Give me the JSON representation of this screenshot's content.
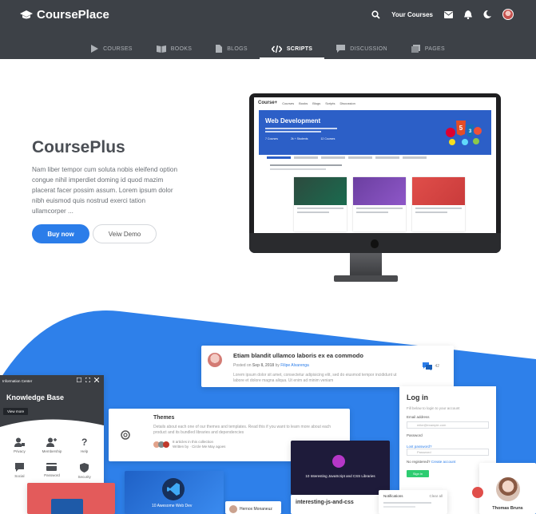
{
  "header": {
    "brand": "CoursePlace",
    "your_courses": "Your Courses",
    "icons": [
      "search-icon",
      "mail-icon",
      "bell-icon",
      "moon-icon",
      "avatar"
    ]
  },
  "tabs": [
    {
      "label": "COURSES",
      "icon": "play-icon",
      "active": false
    },
    {
      "label": "BOOKS",
      "icon": "book-icon",
      "active": false
    },
    {
      "label": "BLOGS",
      "icon": "document-icon",
      "active": false
    },
    {
      "label": "SCRIPTS",
      "icon": "code-icon",
      "active": true
    },
    {
      "label": "DISCUSSION",
      "icon": "chat-icon",
      "active": false
    },
    {
      "label": "PAGES",
      "icon": "pages-icon",
      "active": false
    }
  ],
  "hero": {
    "title": "CoursePlus",
    "text": "Nam liber tempor cum soluta nobis eleifend option congue nihil imperdiet doming id quod mazim placerat facer possim assum. Lorem ipsum dolor nibh euismod quis nostrud exerci tation ullamcorper ...",
    "buy_label": "Buy now",
    "demo_label": "Veiw Demo"
  },
  "screen": {
    "logo": "Course+",
    "hero_title": "Web Development",
    "nav": [
      "Courses",
      "Books",
      "Blogs",
      "Scripts",
      "Discussion"
    ],
    "stats": [
      "7 Courses",
      "2k + Students",
      "12 Courses"
    ]
  },
  "post": {
    "title": "Etiam blandit ullamco laboris ex ea commodo",
    "meta_prefix": "Posted on",
    "date": "Sep 8, 2018",
    "by": "by",
    "author": "Filipe Alvarenga",
    "text": "Lorem ipsum dolor sit amet, consectetur adipisicing elit, sed do eiusmod tempor incididunt ut labore et dolore magna aliqua. Ut enim ad minim veniam",
    "comments": "42"
  },
  "themes": {
    "title": "Themes",
    "text": "Details about each one of our themes and templates. Read this if you want to learn more about each product and its bundled libraries and dependencies",
    "articles": "8 articles in this collection",
    "written": "Written by · Circle Me May agoes"
  },
  "knowledge": {
    "top": "Information Center",
    "title": "Knowledge Base",
    "view_more": "View more",
    "items": [
      "Privacy",
      "Membership",
      "Help",
      "Social",
      "Password",
      "Security"
    ]
  },
  "login": {
    "title": "Log in",
    "subtitle": "Fill below to login to your account",
    "email_label": "Email address",
    "email_placeholder": "mike@example.com",
    "password_label": "Password",
    "password_placeholder": "Password",
    "forgot": "Lost password?",
    "no_account": "No registered?",
    "create": "Create account",
    "signin": "Sign in"
  },
  "bottom": {
    "js_title": "10 Interesting JavaScript and CSS Libraries",
    "js_name": "interesting-js-and-css",
    "web_title": "10 Awesome Web Dev",
    "notifications": "Notifications",
    "clear_all": "Clear all",
    "person": "Hernox Monaneuz",
    "profile_name": "Thomas Bruns"
  },
  "colors": {
    "header": "#3d4147",
    "accent": "#2b7de9",
    "blue_band": "#2e80ea"
  }
}
